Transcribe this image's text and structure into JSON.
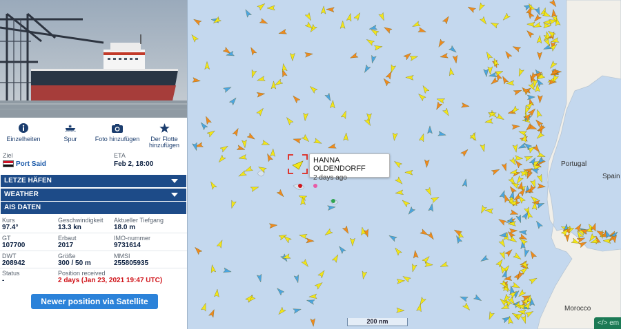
{
  "actions": [
    {
      "label": "Einzelheiten",
      "icon": "info-icon"
    },
    {
      "label": "Spur",
      "icon": "ship-track-icon"
    },
    {
      "label": "Foto hinzufügen",
      "icon": "camera-icon"
    },
    {
      "label": "Der Flotte hinzufügen",
      "icon": "star-icon"
    }
  ],
  "voyage": {
    "dest_label": "Ziel",
    "dest_value": "Port Said",
    "eta_label": "ETA",
    "eta_value": "Feb 2, 18:00"
  },
  "sections": {
    "ports": "LETZE HÄFEN",
    "weather": "WEATHER",
    "ais": "AIS DATEN"
  },
  "ais": {
    "course_label": "Kurs",
    "course": "97.4°",
    "speed_label": "Geschwindigkeit",
    "speed": "13.3 kn",
    "draught_label": "Aktueller Tiefgang",
    "draught": "18.0 m",
    "gt_label": "GT",
    "gt": "107700",
    "built_label": "Erbaut",
    "built": "2017",
    "imo_label": "IMO-nummer",
    "imo": "9731614",
    "dwt_label": "DWT",
    "dwt": "208942",
    "size_label": "Größe",
    "size": "300 / 50 m",
    "mmsi_label": "MMSI",
    "mmsi": "255805935",
    "status_label": "Status",
    "status": "-",
    "pos_label": "Position received",
    "pos": "2 days (Jan 23, 2021 19:47 UTC)"
  },
  "satellite_button": "Newer position via Satellite",
  "map": {
    "tooltip_name": "HANNA OLDENDORFF",
    "tooltip_age": "2 days ago",
    "labels": {
      "portugal": "Portugal",
      "spain": "Spain",
      "morocco": "Morocco"
    },
    "scale": "200 nm",
    "embed": "</> em"
  },
  "colors": {
    "header_blue": "#1d4b88",
    "link_blue": "#1757a8",
    "button_blue": "#2b82d9",
    "alert_red": "#d0141a",
    "ocean": "#c4d8ee",
    "land": "#f1efe9",
    "cargo_yellow": "#f2e618",
    "tanker_orange": "#ee8a1e",
    "passenger_blue": "#4aa5e0",
    "embed_green": "#1c7a55"
  }
}
